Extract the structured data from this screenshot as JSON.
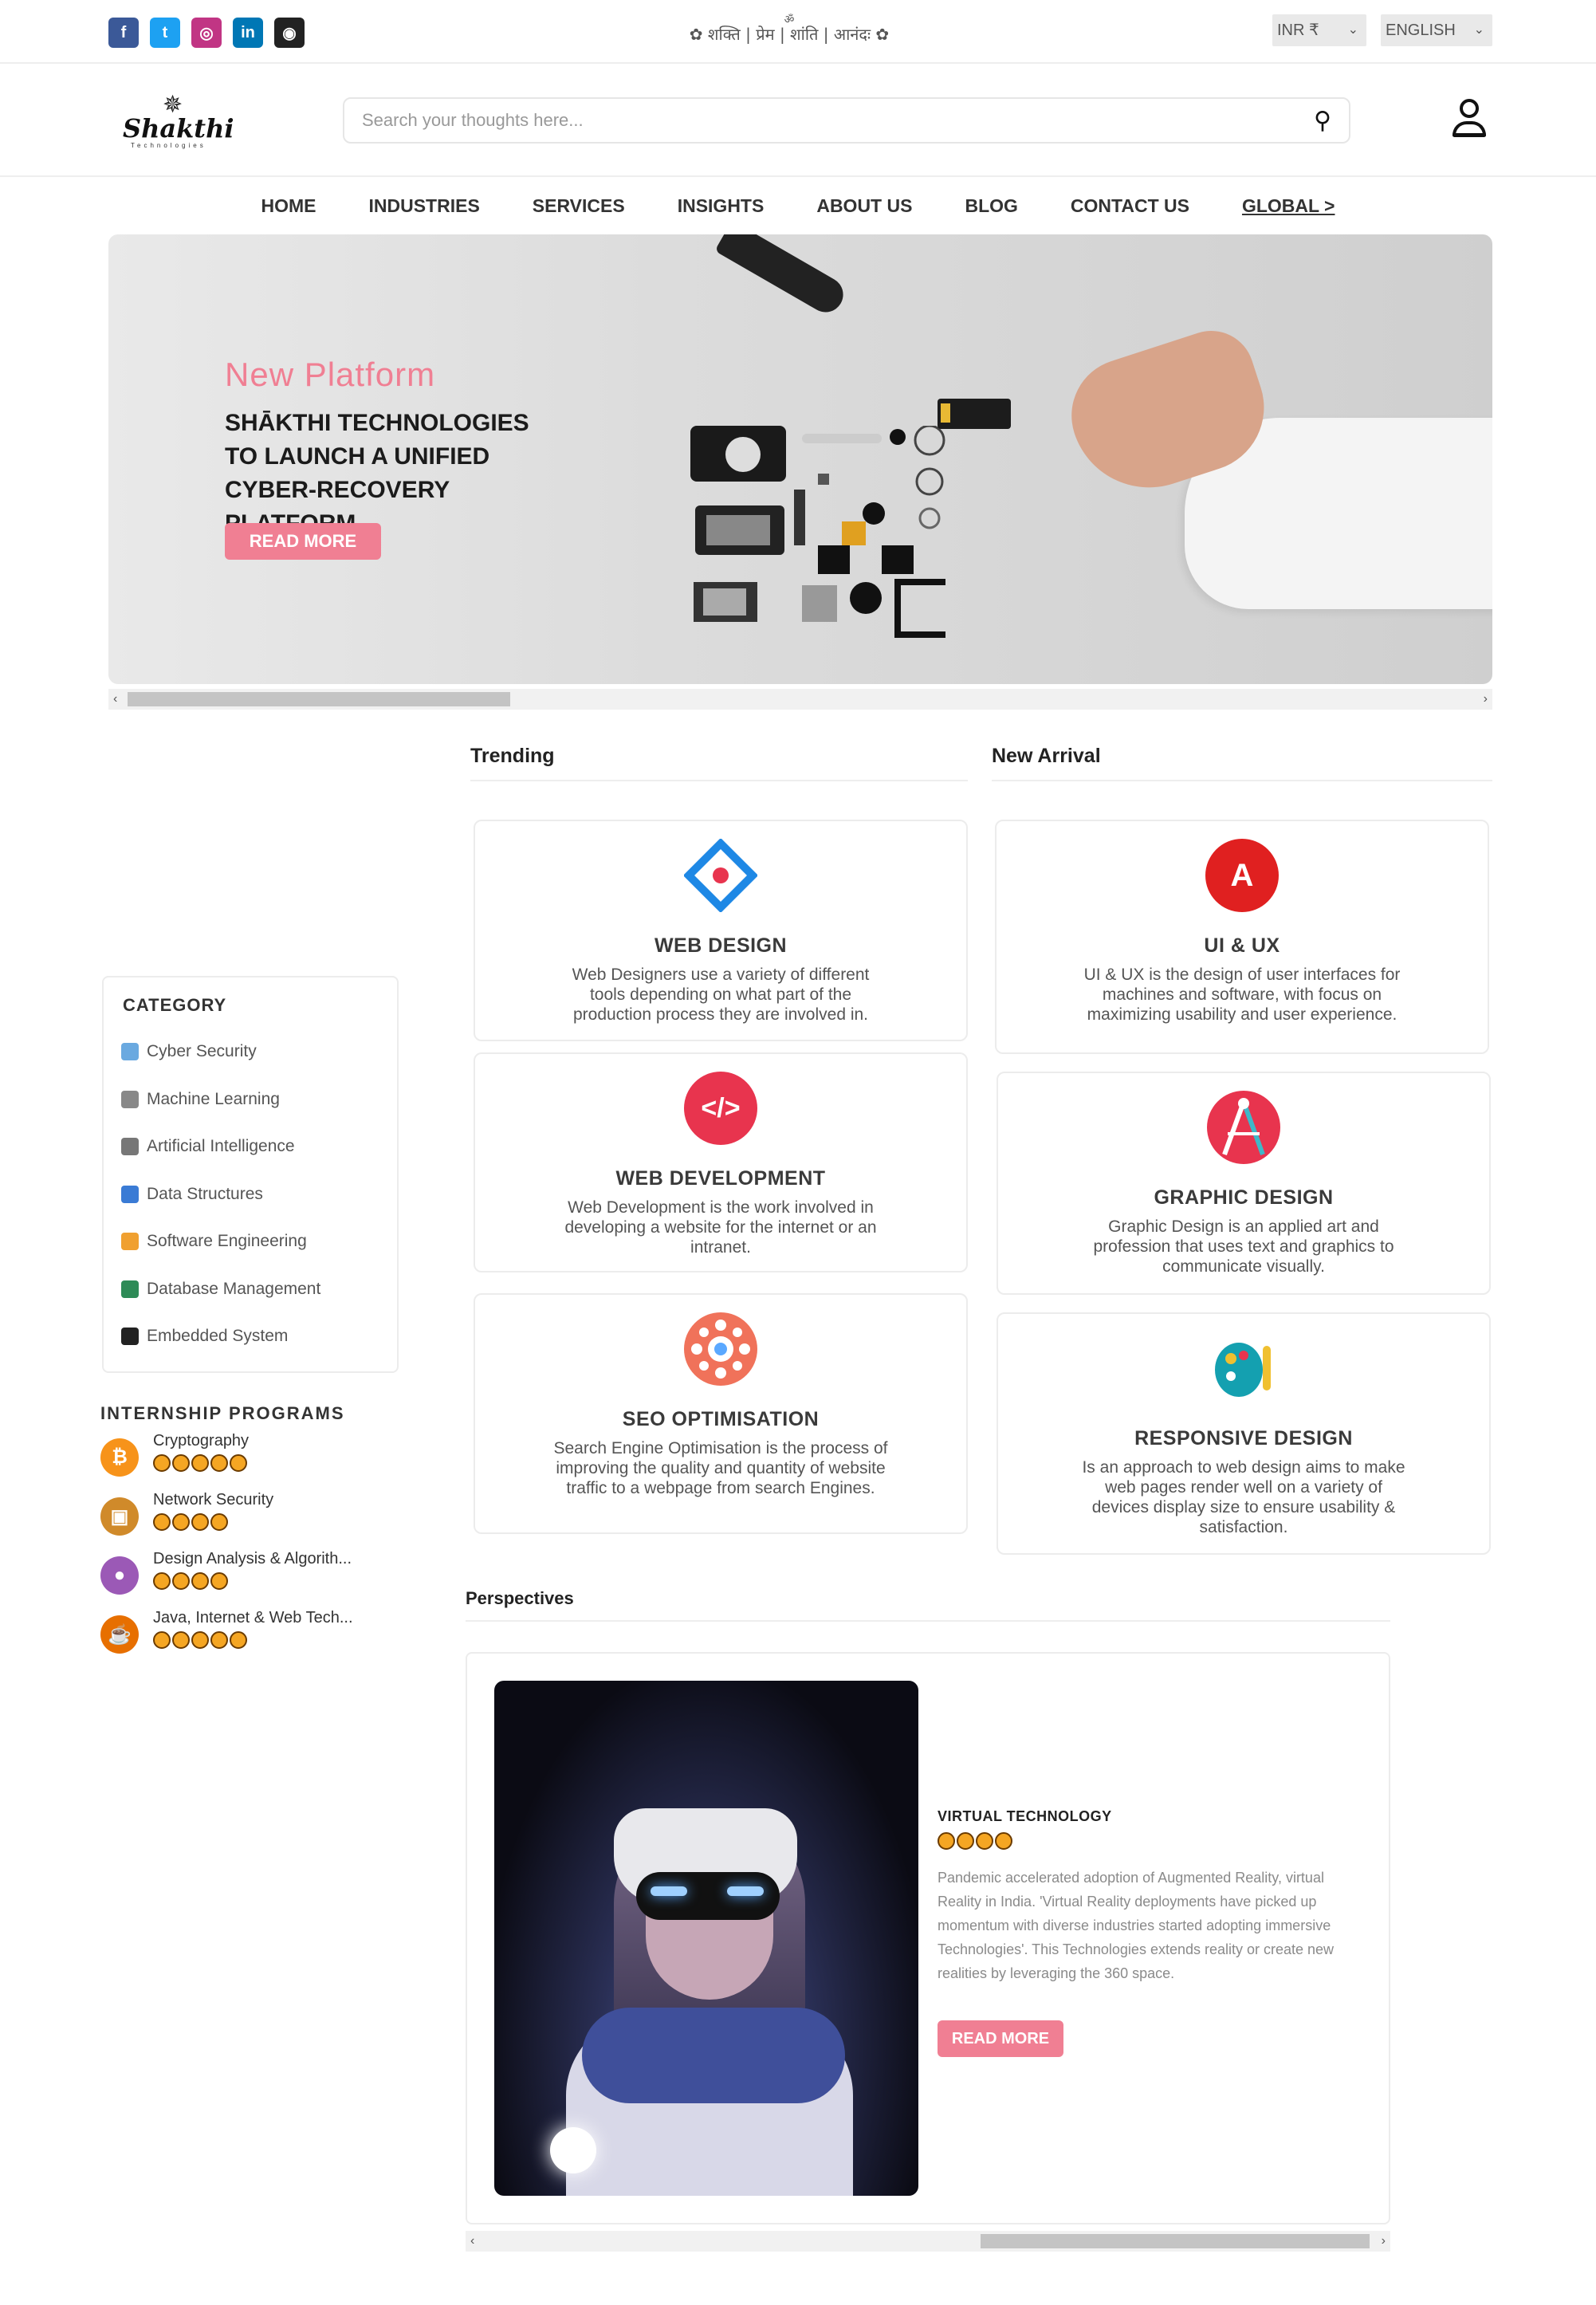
{
  "topbar": {
    "social": [
      {
        "icon": "facebook-icon",
        "glyph": "f",
        "color": "#3b5998"
      },
      {
        "icon": "twitter-icon",
        "glyph": "t",
        "color": "#1da1f2"
      },
      {
        "icon": "instagram-icon",
        "glyph": "◎",
        "color": "#c13584"
      },
      {
        "icon": "linkedin-icon",
        "glyph": "in",
        "color": "#0077b5"
      },
      {
        "icon": "github-icon",
        "glyph": "◉",
        "color": "#222222"
      }
    ],
    "om": "ॐ",
    "tagline": "✿ शक्ति | प्रेम | शांति | आनंदः ✿",
    "currency": "INR ₹",
    "language": "ENGLISH"
  },
  "header": {
    "logo_name": "Shakthi",
    "logo_sub": "Technologies",
    "search_placeholder": "Search your thoughts here..."
  },
  "nav": [
    "HOME",
    "INDUSTRIES",
    "SERVICES",
    "INSIGHTS",
    "ABOUT US",
    "BLOG",
    "CONTACT US",
    "GLOBAL >"
  ],
  "hero": {
    "kicker": "New Platform",
    "headline": "SHĀKTHI TECHNOLOGIES TO LAUNCH A UNIFIED CYBER-RECOVERY PLATFORM.",
    "button": "READ MORE",
    "scroll_position": 0.3
  },
  "trending": {
    "title": "Trending",
    "cards": [
      {
        "title": "WEB DESIGN",
        "desc": "Web Designers use a variety of different tools depending on what part of the production process they are involved in.",
        "icon": "web-design-icon",
        "color": "#1e88e5"
      },
      {
        "title": "WEB DEVELOPMENT",
        "desc": "Web Development is the work involved in developing a website for the internet or an intranet.",
        "icon": "code-icon",
        "color": "#e8344e"
      },
      {
        "title": "SEO OPTIMISATION",
        "desc": "Search Engine Optimisation is the process of improving the quality and quantity of website traffic to a webpage from search Engines.",
        "icon": "seo-icon",
        "color": "#f0725a"
      }
    ]
  },
  "new_arrival": {
    "title": "New Arrival",
    "cards": [
      {
        "title": "UI & UX",
        "desc": "UI & UX is the design of user interfaces for machines and software, with focus on maximizing usability and user experience.",
        "icon": "adobe-icon",
        "color": "#e02020"
      },
      {
        "title": "GRAPHIC DESIGN",
        "desc": "Graphic Design is an applied art and profession that uses text and graphics to communicate visually.",
        "icon": "compass-icon",
        "color": "#e8344e"
      },
      {
        "title": "RESPONSIVE DESIGN",
        "desc": "Is an approach to web design aims to make web pages render well on a variety of devices display size to ensure usability & satisfaction.",
        "icon": "palette-icon",
        "color": "#14a0b0"
      }
    ]
  },
  "category": {
    "title": "CATEGORY",
    "items": [
      {
        "label": "Cyber Security",
        "color": "#6aa9e0"
      },
      {
        "label": "Machine Learning",
        "color": "#888888"
      },
      {
        "label": "Artificial Intelligence",
        "color": "#777777"
      },
      {
        "label": "Data Structures",
        "color": "#3a7bd5"
      },
      {
        "label": "Software Engineering",
        "color": "#f0a030"
      },
      {
        "label": "Database Management",
        "color": "#2e8b57"
      },
      {
        "label": "Embedded System",
        "color": "#222222"
      }
    ]
  },
  "internship": {
    "title": "INTERNSHIP PROGRAMS",
    "items": [
      {
        "label": "Cryptography",
        "stars": 5,
        "icon": "bitcoin-icon",
        "glyph": "₿",
        "color": "#f7931a"
      },
      {
        "label": "Network Security",
        "stars": 4,
        "icon": "network-security-icon",
        "glyph": "▣",
        "color": "#d08a2a"
      },
      {
        "label": "Design Analysis & Algorith...",
        "stars": 4,
        "icon": "algorithm-icon",
        "glyph": "●",
        "color": "#9b59b6"
      },
      {
        "label": "Java, Internet & Web Tech...",
        "stars": 5,
        "icon": "java-icon",
        "glyph": "☕",
        "color": "#e76f00"
      }
    ]
  },
  "perspectives": {
    "title": "Perspectives",
    "card_title": "VIRTUAL TECHNOLOGY",
    "stars": 4,
    "text": "Pandemic accelerated adoption of Augmented Reality, virtual Reality in India. 'Virtual Reality deployments have picked up momentum with diverse industries started adopting immersive Technologies'. This Technologies extends reality or create new realities by leveraging the 360 space.",
    "button": "READ MORE",
    "scroll_position": 0.65
  }
}
